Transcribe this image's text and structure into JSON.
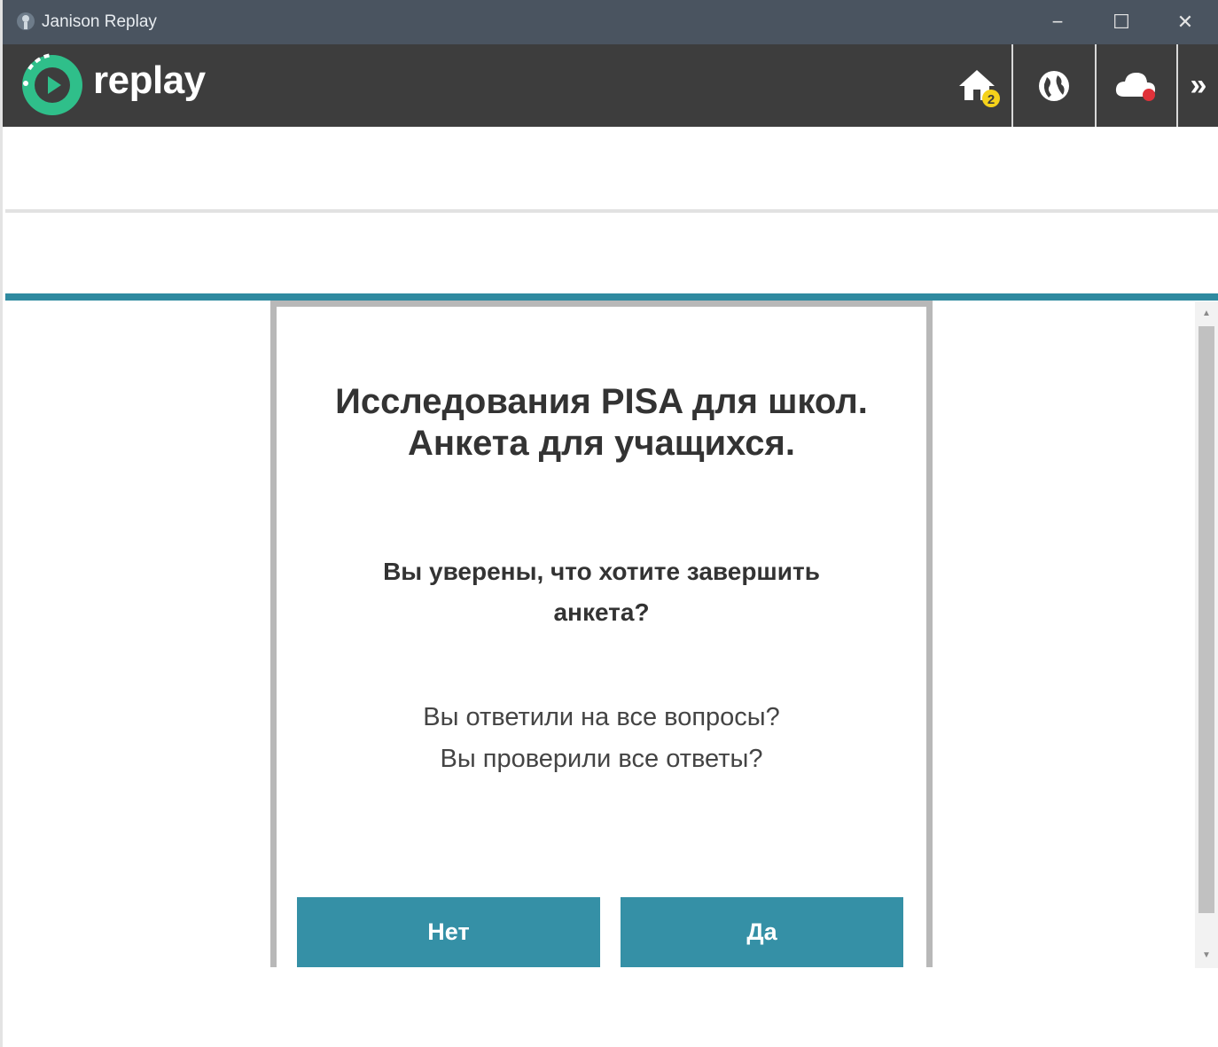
{
  "window": {
    "title": "Janison Replay",
    "controls": {
      "minimize": "−",
      "maximize": "☐",
      "close": "✕"
    }
  },
  "toolbar": {
    "logo_text": "replay",
    "home_badge": "2",
    "more_label": "»",
    "icons": [
      "home-icon",
      "globe-icon",
      "cloud-icon",
      "chevron-double-right-icon"
    ],
    "colors": {
      "background": "#3d3d3d",
      "logo_green": "#2fbf8a",
      "badge_yellow": "#f5d21b",
      "status_red": "#e0323a"
    }
  },
  "dialog": {
    "title_line1": "Исследования PISA для школ.",
    "title_line2": "Анкета для учащихся.",
    "question_line1": "Вы уверены, что хотите завершить",
    "question_line2": "анкета?",
    "hint_line1": "Вы ответили на все вопросы?",
    "hint_line2": "Вы проверили все ответы?",
    "no_label": "Нет",
    "yes_label": "Да",
    "accent_color": "#3590a6"
  },
  "scrollbar": {
    "up": "▲",
    "down": "▼"
  }
}
